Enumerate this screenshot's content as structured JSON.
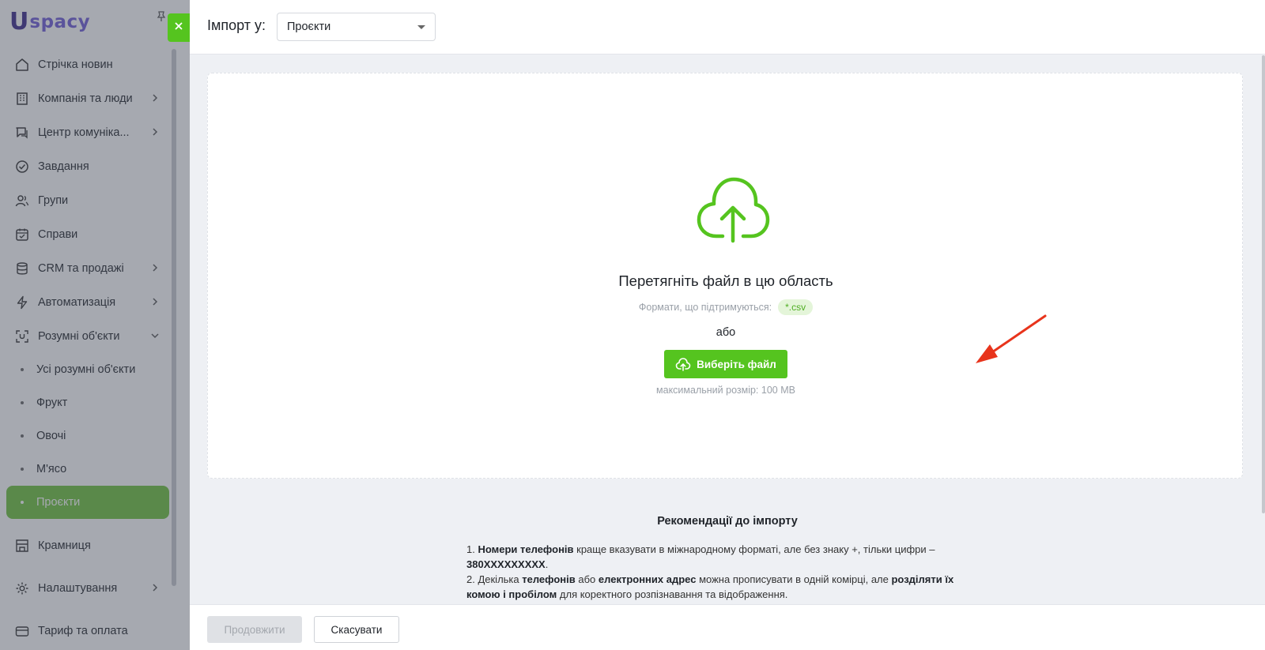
{
  "logo": {
    "mark": "U",
    "word": "spacy"
  },
  "sidebar": {
    "items": [
      {
        "label": "Стрічка новин",
        "icon": "home-icon",
        "chevron": false
      },
      {
        "label": "Компанія та люди",
        "icon": "building-icon",
        "chevron": true
      },
      {
        "label": "Центр комуніка...",
        "icon": "chat-icon",
        "chevron": true
      },
      {
        "label": "Завдання",
        "icon": "check-circle-icon",
        "chevron": false
      },
      {
        "label": "Групи",
        "icon": "users-icon",
        "chevron": false
      },
      {
        "label": "Справи",
        "icon": "calendar-icon",
        "chevron": false
      },
      {
        "label": "CRM та продажі",
        "icon": "database-icon",
        "chevron": true
      },
      {
        "label": "Автоматизація",
        "icon": "lightning-icon",
        "chevron": true
      },
      {
        "label": "Розумні об'єкти",
        "icon": "smart-object-icon",
        "chevron": "down"
      }
    ],
    "sub_items": [
      {
        "label": "Усі розумні об'єкти"
      },
      {
        "label": "Фрукт"
      },
      {
        "label": "Овочі"
      },
      {
        "label": "М'ясо"
      },
      {
        "label": "Проєкти",
        "active": true
      }
    ],
    "bottom_items": [
      {
        "label": "Крамниця",
        "icon": "store-icon",
        "chevron": false
      },
      {
        "label": "Налаштування",
        "icon": "gear-icon",
        "chevron": true
      },
      {
        "label": "Тариф та оплата",
        "icon": "card-icon",
        "chevron": false
      }
    ],
    "active_color": "#6ec13c"
  },
  "header": {
    "import_label": "Імпорт у:",
    "select_value": "Проєкти"
  },
  "dropzone": {
    "title": "Перетягніть файл в цю область",
    "formats_label": "Формати, що підтримуються:",
    "format_badge": "*.csv",
    "or_text": "або",
    "choose_button": "Виберіть файл",
    "max_size": "максимальний розмір: 100 MB"
  },
  "recommendations": {
    "title": "Рекомендації до імпорту",
    "item1": {
      "num": "1. ",
      "bold1": "Номери телефонів",
      "text1": " краще вказувати в міжнародному форматі, але без знаку +, тільки цифри – ",
      "bold2": "380XXXXXXXXX",
      "text2": "."
    },
    "item2": {
      "num": "2. Декілька ",
      "bold1": "телефонів",
      "text1": " або ",
      "bold2": "електронних адрес",
      "text2": " можна прописувати в одній комірці, але ",
      "bold3": "розділяти їх комою і пробілом",
      "text3": " для коректного розпізнавання та відображення."
    }
  },
  "footer": {
    "continue": "Продовжити",
    "cancel": "Скасувати"
  },
  "colors": {
    "accent": "#55c41f",
    "annotation_arrow": "#e8341c"
  }
}
